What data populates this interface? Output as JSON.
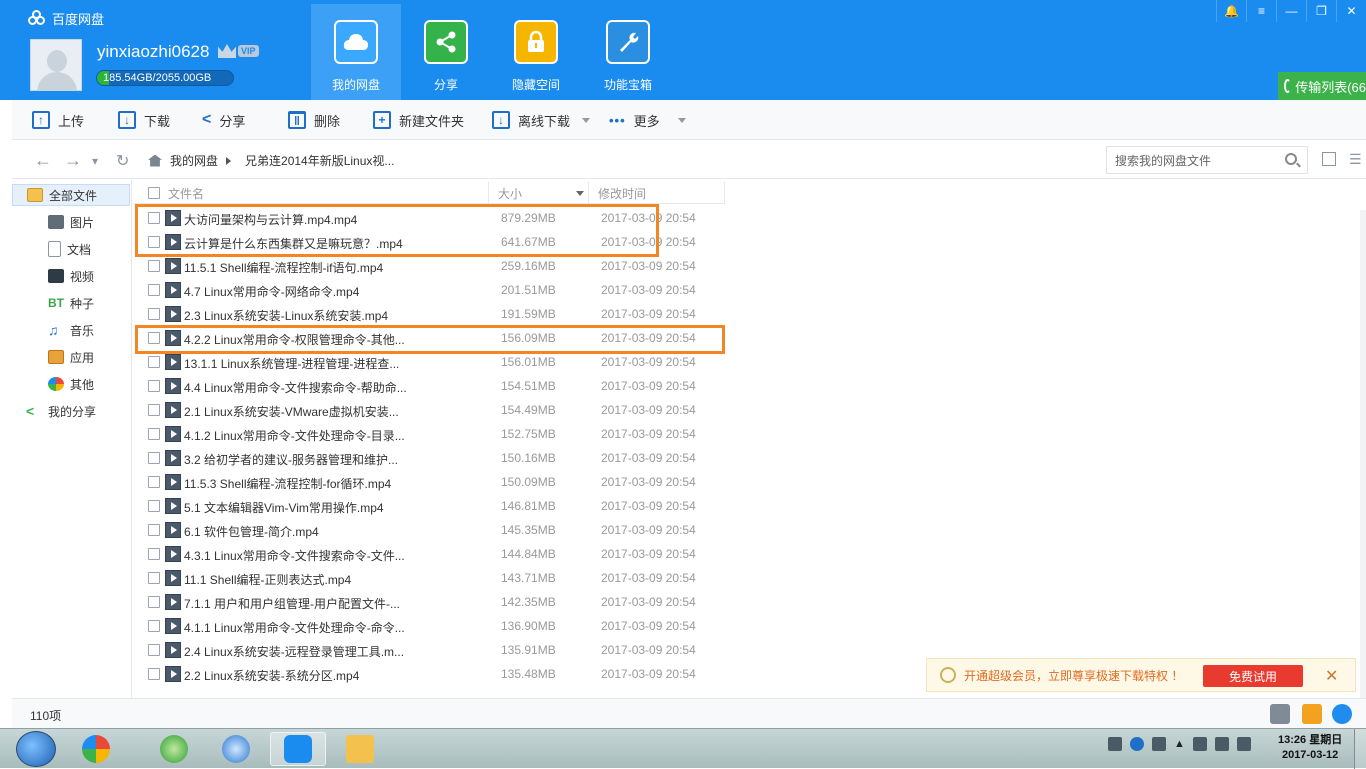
{
  "app": {
    "title": "百度网盘"
  },
  "user": {
    "name": "yinxiaozhi0628",
    "vip_label": "VIP",
    "quota_text": "185.54GB/2055.00GB",
    "quota_fraction": 0.09
  },
  "nav_tabs": [
    {
      "label": "我的网盘",
      "icon": "cloud-disk-icon"
    },
    {
      "label": "分享",
      "icon": "share-icon"
    },
    {
      "label": "隐藏空间",
      "icon": "lock-icon"
    },
    {
      "label": "功能宝箱",
      "icon": "toolbox-icon"
    }
  ],
  "transfer_button": "传输列表(66",
  "toolbar": {
    "upload": "上传",
    "download": "下载",
    "share": "分享",
    "delete": "删除",
    "new_folder": "新建文件夹",
    "offline_download": "离线下载",
    "more": "更多"
  },
  "address": {
    "root": "我的网盘",
    "folder": "兄弟连2014年新版Linux视...",
    "search_placeholder": "搜索我的网盘文件"
  },
  "sidebar": {
    "items": [
      {
        "label": "全部文件",
        "icon": "folder-icon"
      },
      {
        "label": "图片",
        "icon": "image-icon"
      },
      {
        "label": "文档",
        "icon": "document-icon"
      },
      {
        "label": "视频",
        "icon": "video-icon"
      },
      {
        "label": "种子",
        "icon": "bt-icon"
      },
      {
        "label": "音乐",
        "icon": "music-icon"
      },
      {
        "label": "应用",
        "icon": "app-icon"
      },
      {
        "label": "其他",
        "icon": "other-icon"
      },
      {
        "label": "我的分享",
        "icon": "share-icon"
      }
    ]
  },
  "columns": {
    "name": "文件名",
    "size": "大小",
    "modified": "修改时间"
  },
  "files": [
    {
      "name": "大访问量架构与云计算.mp4.mp4",
      "size": "879.29MB",
      "date": "2017-03-09 20:54"
    },
    {
      "name": "云计算是什么东西集群又是嘛玩意？.mp4",
      "size": "641.67MB",
      "date": "2017-03-09 20:54"
    },
    {
      "name": "11.5.1 Shell编程-流程控制-if语句.mp4",
      "size": "259.16MB",
      "date": "2017-03-09 20:54"
    },
    {
      "name": "4.7 Linux常用命令-网络命令.mp4",
      "size": "201.51MB",
      "date": "2017-03-09 20:54"
    },
    {
      "name": "2.3 Linux系统安装-Linux系统安装.mp4",
      "size": "191.59MB",
      "date": "2017-03-09 20:54"
    },
    {
      "name": "4.2.2 Linux常用命令-权限管理命令-其他...",
      "size": "156.09MB",
      "date": "2017-03-09 20:54"
    },
    {
      "name": "13.1.1 Linux系统管理-进程管理-进程查...",
      "size": "156.01MB",
      "date": "2017-03-09 20:54"
    },
    {
      "name": "4.4 Linux常用命令-文件搜索命令-帮助命...",
      "size": "154.51MB",
      "date": "2017-03-09 20:54"
    },
    {
      "name": "2.1 Linux系统安装-VMware虚拟机安装...",
      "size": "154.49MB",
      "date": "2017-03-09 20:54"
    },
    {
      "name": "4.1.2 Linux常用命令-文件处理命令-目录...",
      "size": "152.75MB",
      "date": "2017-03-09 20:54"
    },
    {
      "name": "3.2 给初学者的建议-服务器管理和维护...",
      "size": "150.16MB",
      "date": "2017-03-09 20:54"
    },
    {
      "name": "11.5.3 Shell编程-流程控制-for循环.mp4",
      "size": "150.09MB",
      "date": "2017-03-09 20:54"
    },
    {
      "name": "5.1 文本编辑器Vim-Vim常用操作.mp4",
      "size": "146.81MB",
      "date": "2017-03-09 20:54"
    },
    {
      "name": "6.1 软件包管理-简介.mp4",
      "size": "145.35MB",
      "date": "2017-03-09 20:54"
    },
    {
      "name": "4.3.1 Linux常用命令-文件搜索命令-文件...",
      "size": "144.84MB",
      "date": "2017-03-09 20:54"
    },
    {
      "name": "11.1 Shell编程-正则表达式.mp4",
      "size": "143.71MB",
      "date": "2017-03-09 20:54"
    },
    {
      "name": "7.1.1 用户和用户组管理-用户配置文件-...",
      "size": "142.35MB",
      "date": "2017-03-09 20:54"
    },
    {
      "name": "4.1.1 Linux常用命令-文件处理命令-命令...",
      "size": "136.90MB",
      "date": "2017-03-09 20:54"
    },
    {
      "name": "2.4 Linux系统安装-远程登录管理工具.m...",
      "size": "135.91MB",
      "date": "2017-03-09 20:54"
    },
    {
      "name": "2.2 Linux系统安装-系统分区.mp4",
      "size": "135.48MB",
      "date": "2017-03-09 20:54"
    }
  ],
  "promo": {
    "message": "开通超级会员，立即尊享极速下载特权 ！",
    "button": "免费试用",
    "close": "✕"
  },
  "status": {
    "count": "110项"
  },
  "taskbar": {
    "time": "13:26 星期日",
    "date": "2017-03-12"
  },
  "colors": {
    "header_blue": "#1a8cf0",
    "highlight_orange": "#f38624",
    "promo_red": "#e83a2f",
    "transfer_green": "#3bb34a"
  }
}
